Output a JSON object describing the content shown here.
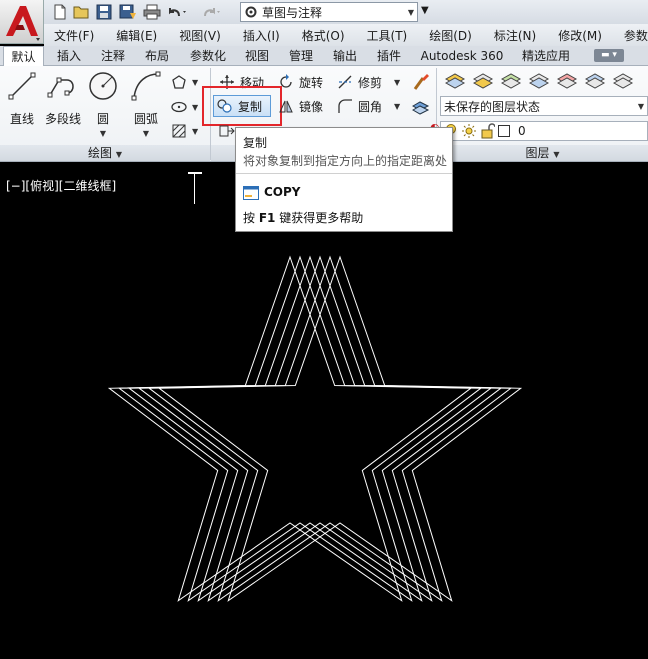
{
  "titlebar": {
    "workspace": "草图与注释"
  },
  "menubar": {
    "items": [
      "文件(F)",
      "编辑(E)",
      "视图(V)",
      "插入(I)",
      "格式(O)",
      "工具(T)",
      "绘图(D)",
      "标注(N)",
      "修改(M)",
      "参数"
    ]
  },
  "tabs": {
    "items": [
      "默认",
      "插入",
      "注释",
      "布局",
      "参数化",
      "视图",
      "管理",
      "输出",
      "插件",
      "Autodesk 360",
      "精选应用"
    ],
    "active": "默认"
  },
  "ribbon": {
    "draw_panel": {
      "line": "直线",
      "polyline": "多段线",
      "circle": "圆",
      "arc": "圆弧",
      "title": "绘图"
    },
    "modify_panel": {
      "move": "移动",
      "rotate": "旋转",
      "trim": "修剪",
      "copy": "复制",
      "mirror": "镜像",
      "fillet": "圆角"
    },
    "layers_panel": {
      "layer_state": "未保存的图层状态",
      "current_layer": "0",
      "title": "图层"
    }
  },
  "viewport": {
    "label": "[−][俯视][二维线框]"
  },
  "tooltip": {
    "title": "复制",
    "description": "将对象复制到指定方向上的指定距离处",
    "command": "COPY",
    "help_prefix": "按",
    "help_key": "F1",
    "help_suffix": "键获得更多帮助"
  },
  "colors": {
    "highlight_box": "#e3262b",
    "app_button": "#c8191e",
    "star_lines": "#ffffff"
  }
}
